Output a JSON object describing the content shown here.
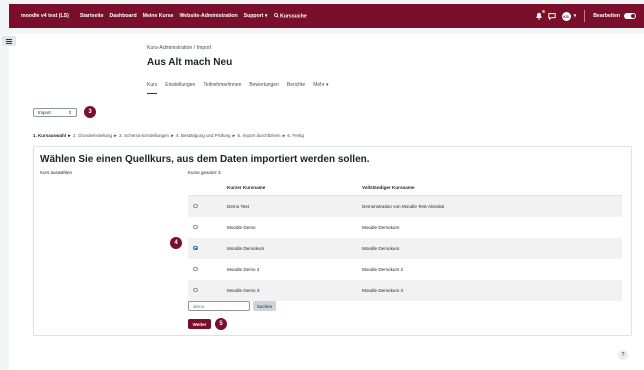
{
  "navbar": {
    "site_name": "moodle v4 test (LS)",
    "links": [
      "Startseite",
      "Dashboard",
      "Meine Kurse",
      "Website-Administration",
      "Support ▾"
    ],
    "search_label": "Kurssuche",
    "avatar_initials": "KS",
    "avatar_caret": "▾",
    "edit_mode_label": "Bearbeiten",
    "brand_color": "#7a0f2b"
  },
  "header": {
    "breadcrumb": "Kurs-Administration / Import",
    "title": "Aus Alt mach Neu"
  },
  "tabs": [
    {
      "label": "Kurs"
    },
    {
      "label": "Einstellungen"
    },
    {
      "label": "Teilnehmer/innen"
    },
    {
      "label": "Bewertungen"
    },
    {
      "label": "Berichte"
    },
    {
      "label": "Mehr ▾"
    }
  ],
  "import_select": {
    "value": "Import",
    "arrow": "⇕"
  },
  "badges": {
    "b3": "3",
    "b4": "4",
    "b5": "5"
  },
  "steps": {
    "current": "1. Kursauswahl ►",
    "rest": "2. Grundeinstellung ► 3. Schema-Einstellungen ► 4. Bestätigung und Prüfung ► 5. Import durchführen ► 6. Fertig"
  },
  "main": {
    "heading": "Wählen Sie einen Quellkurs, aus dem Daten importiert werden sollen.",
    "left_label": "Kurs auswählen",
    "total": "Kurse gesamt: 5"
  },
  "table": {
    "headers": [
      "",
      "Kurzer Kursname",
      "Vollständiger Kursname"
    ],
    "rows": [
      {
        "short": "Demo Test",
        "full": "Demonstration von Moodle Test-Aktivität",
        "selected": false
      },
      {
        "short": "Moodle Demo",
        "full": "Moodle Demokurs",
        "selected": false
      },
      {
        "short": "Moodle Demokurs",
        "full": "Moodle Demokurs",
        "selected": true
      },
      {
        "short": "Moodle Demo 2",
        "full": "Moodle Demokurs 2",
        "selected": false
      },
      {
        "short": "Moodle Demo 3",
        "full": "Moodle Demokurs 3",
        "selected": false
      }
    ]
  },
  "search": {
    "value": "demo",
    "button": "Suchen"
  },
  "continue_button": "Weiter",
  "help_label": "?"
}
